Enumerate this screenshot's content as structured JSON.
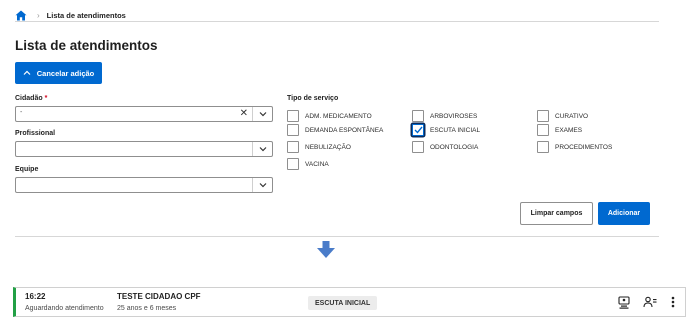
{
  "breadcrumb": {
    "current": "Lista de atendimentos"
  },
  "page": {
    "title": "Lista de atendimentos"
  },
  "actions": {
    "cancel_label": "Cancelar adição",
    "clear_label": "Limpar campos",
    "add_label": "Adicionar"
  },
  "form": {
    "cidadao": {
      "label": "Cidadão",
      "required_mark": "*",
      "value": "-"
    },
    "profissional": {
      "label": "Profissional",
      "value": ""
    },
    "equipe": {
      "label": "Equipe",
      "value": ""
    },
    "servico": {
      "label": "Tipo de serviço",
      "options": [
        {
          "label": "ADM. MEDICAMENTO",
          "checked": false
        },
        {
          "label": "ARBOVIROSES",
          "checked": false
        },
        {
          "label": "CURATIVO",
          "checked": false
        },
        {
          "label": "DEMANDA ESPONTÂNEA",
          "checked": false
        },
        {
          "label": "ESCUTA INICIAL",
          "checked": true
        },
        {
          "label": "EXAMES",
          "checked": false
        },
        {
          "label": "NEBULIZAÇÃO",
          "checked": false
        },
        {
          "label": "ODONTOLOGIA",
          "checked": false
        },
        {
          "label": "PROCEDIMENTOS",
          "checked": false
        },
        {
          "label": "VACINA",
          "checked": false
        }
      ]
    }
  },
  "queue": [
    {
      "time": "16:22",
      "status": "Aguardando atendimento",
      "name": "TESTE CIDADAO CPF",
      "age": "25 anos e 6 meses",
      "service": "ESCUTA INICIAL"
    }
  ],
  "colors": {
    "primary": "#0069d0",
    "status_waiting": "#22a045",
    "arrow": "#4a7cc9"
  },
  "icons": [
    "home-icon",
    "chevron-up-icon",
    "clear-icon",
    "chevron-down-icon",
    "arrow-down-icon",
    "monitor-person-icon",
    "people-icon",
    "more-vertical-icon"
  ]
}
